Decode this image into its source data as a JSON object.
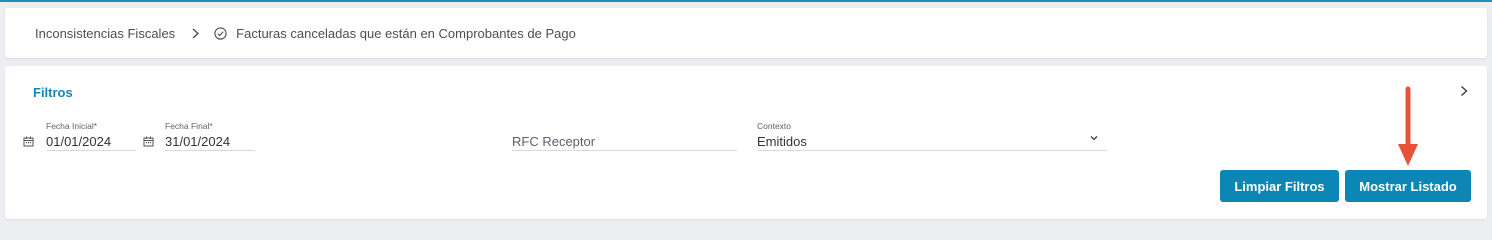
{
  "breadcrumb": {
    "root": "Inconsistencias Fiscales",
    "current": "Facturas canceladas que están en Comprobantes de Pago"
  },
  "filters": {
    "title": "Filtros",
    "fecha_inicial": {
      "label": "Fecha Inicial*",
      "value": "01/01/2024"
    },
    "fecha_final": {
      "label": "Fecha Final*",
      "value": "31/01/2024"
    },
    "rfc_receptor": {
      "placeholder": "RFC Receptor",
      "value": ""
    },
    "contexto": {
      "label": "Contexto",
      "value": "Emitidos"
    },
    "buttons": {
      "clear": "Limpiar Filtros",
      "show": "Mostrar Listado"
    }
  },
  "colors": {
    "accent": "#0c86b4",
    "title": "#1385b6",
    "annotation_arrow": "#e8513a",
    "background": "#eceef2"
  },
  "icons": {
    "separator": "chevron-right-icon",
    "status": "check-circle-icon",
    "date": "calendar-icon",
    "expand": "chevron-right-icon",
    "dropdown": "chevron-down-icon"
  }
}
